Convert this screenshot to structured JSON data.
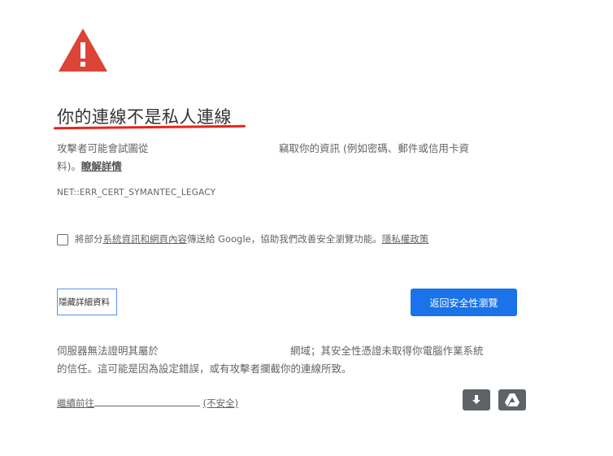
{
  "title": "你的連線不是私人連線",
  "intro": {
    "line1_part1": "攻擊者可能會試圖從",
    "line1_part2": "竊取你的資訊 (例如密碼、郵件或信用卡資",
    "line2_prefix": "料)。",
    "learn_more": "瞭解詳情"
  },
  "error_code": "NET::ERR_CERT_SYMANTEC_LEGACY",
  "opt_in": {
    "prefix": "將部分",
    "link1": "系統資訊和網頁內容",
    "middle": "傳送給 Google，協助我們改善安全瀏覽功能。",
    "link2": "隱私權政策"
  },
  "buttons": {
    "hide_details": "隱藏詳細資料",
    "back_to_safety": "返回安全性瀏覽"
  },
  "details": {
    "line1_part1": "伺服器無法證明其屬於",
    "line1_part2": "網域；其安全性憑證未取得你電腦作業系統",
    "line2": "的信任。這可能是因為設定錯誤，或有攻擊者攔截你的連線所致。"
  },
  "proceed": {
    "prefix": "繼續前往",
    "suffix": "(不安全)"
  },
  "colors": {
    "warning_red": "#db4437",
    "title_underline": "#e8231b",
    "primary_blue": "#1a73e8",
    "icon_button_gray": "#5f6368"
  },
  "icons": {
    "warning": "warning-triangle-icon",
    "download": "download-arrow-icon",
    "drive": "google-drive-icon"
  }
}
